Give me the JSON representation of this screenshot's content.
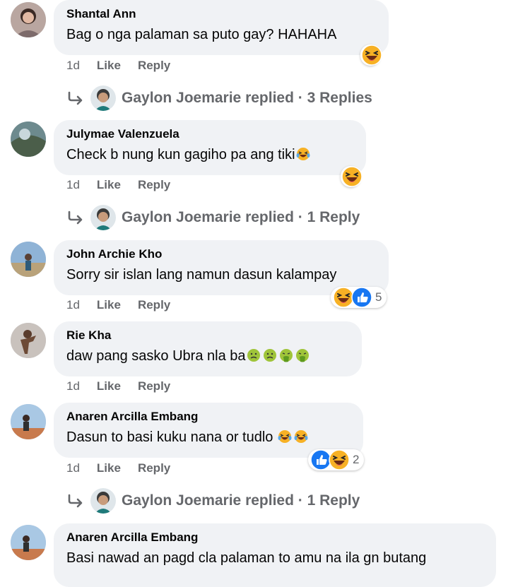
{
  "comments": [
    {
      "author": "Shantal Ann",
      "text": "Bag o nga palaman sa puto gay? HAHAHA",
      "time": "1d",
      "like": "Like",
      "reply": "Reply",
      "reactions": [
        "haha"
      ],
      "replies": {
        "text": "Gaylon Joemarie replied · 3 Replies"
      }
    },
    {
      "author": "Julymae Valenzuela",
      "text": "Check b nung kun gagiho pa ang tiki",
      "inline_emojis": [
        "laughing-tears"
      ],
      "time": "1d",
      "like": "Like",
      "reply": "Reply",
      "reactions": [
        "haha"
      ],
      "replies": {
        "text": "Gaylon Joemarie replied · 1 Reply"
      }
    },
    {
      "author": "John Archie Kho",
      "text": "Sorry sir islan lang namun dasun kalampay",
      "time": "1d",
      "like": "Like",
      "reply": "Reply",
      "reactions": [
        "haha",
        "like"
      ],
      "reaction_count": "5"
    },
    {
      "author": "Rie Kha",
      "text": "daw pang sasko Ubra nla ba",
      "inline_emojis": [
        "nauseated",
        "nauseated",
        "vomiting",
        "vomiting"
      ],
      "time": "1d",
      "like": "Like",
      "reply": "Reply"
    },
    {
      "author": "Anaren Arcilla Embang",
      "text": "Dasun to basi kuku nana or tudlo ",
      "inline_emojis": [
        "laughing-tears",
        "laughing-tears"
      ],
      "time": "1d",
      "like": "Like",
      "reply": "Reply",
      "reactions": [
        "like",
        "haha"
      ],
      "reaction_count": "2",
      "replies": {
        "text": "Gaylon Joemarie replied · 1 Reply"
      }
    },
    {
      "author": "Anaren Arcilla Embang",
      "text": "Basi nawad an pagd cla palaman to amu na ila gn butang"
    }
  ],
  "colors": {
    "bubble": "#f0f2f5",
    "secondary_text": "#65676b",
    "like_blue": "#1877f2",
    "haha_yellow": "#f7b125"
  },
  "icons": [
    "reply-arrow-icon",
    "haha-reaction-icon",
    "like-reaction-icon",
    "laughing-tears-emoji",
    "nauseated-emoji",
    "vomiting-emoji"
  ]
}
